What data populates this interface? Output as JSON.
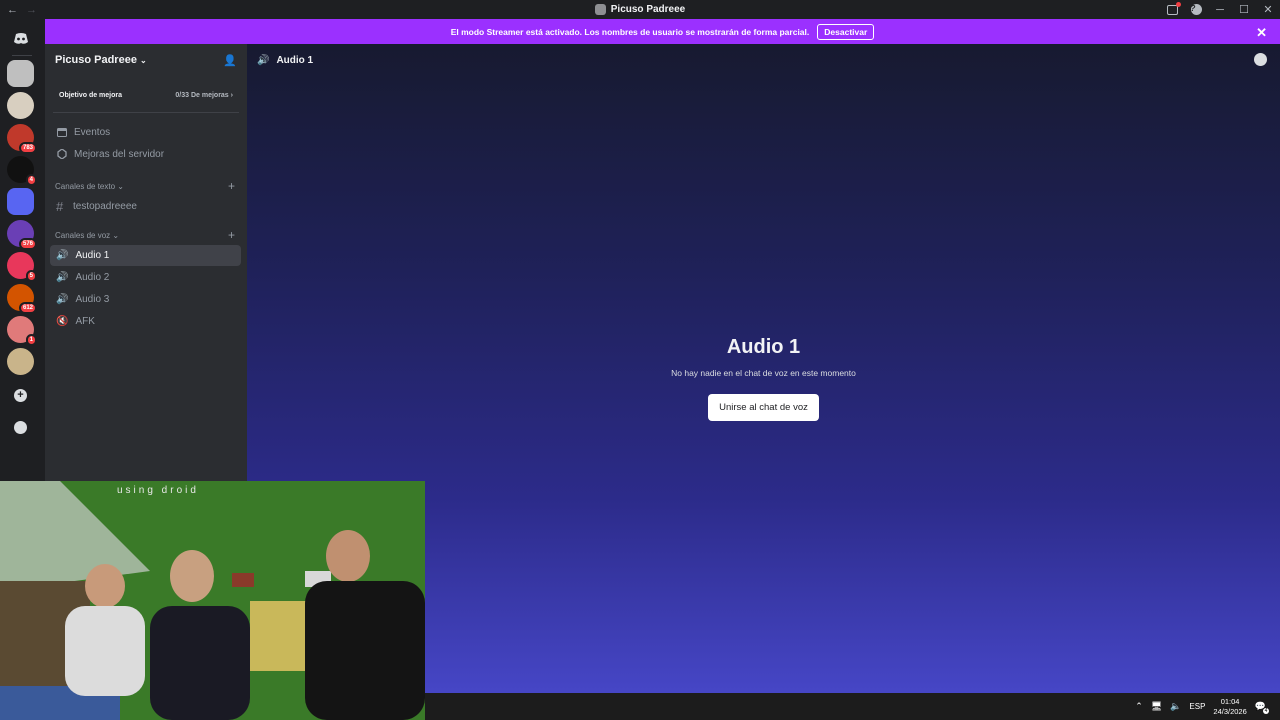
{
  "window": {
    "title": "Picuso Padreee"
  },
  "banner": {
    "message": "El modo Streamer está activado. Los nombres de usuario se mostrarán de forma parcial.",
    "button": "Desactivar",
    "color": "#9b30ff"
  },
  "rail": {
    "badges": [
      "783",
      "4",
      "576",
      "5",
      "612",
      "1"
    ]
  },
  "sidebar": {
    "server_name": "Picuso Padreee",
    "boost_goal": "Objetivo de mejora",
    "boost_count": "0/33 De mejoras",
    "links": [
      {
        "label": "Eventos",
        "icon": "calendar-icon"
      },
      {
        "label": "Mejoras del servidor",
        "icon": "boost-icon"
      }
    ],
    "text_category": "Canales de texto",
    "text_channels": [
      "testopadreeee"
    ],
    "voice_category": "Canales de voz",
    "voice_channels": [
      {
        "label": "Audio 1",
        "active": true
      },
      {
        "label": "Audio 2",
        "active": false
      },
      {
        "label": "Audio 3",
        "active": false
      },
      {
        "label": "AFK",
        "active": false
      }
    ]
  },
  "main": {
    "header": "Audio 1",
    "title": "Audio 1",
    "subtitle": "No hay nadie en el chat de voz en este momento",
    "join_button": "Unirse al chat de voz"
  },
  "webcam": {
    "watermark": "using droid"
  },
  "taskbar": {
    "lang": "ESP",
    "time": "01:04",
    "date": "24/3/2026",
    "notifications": "4"
  }
}
